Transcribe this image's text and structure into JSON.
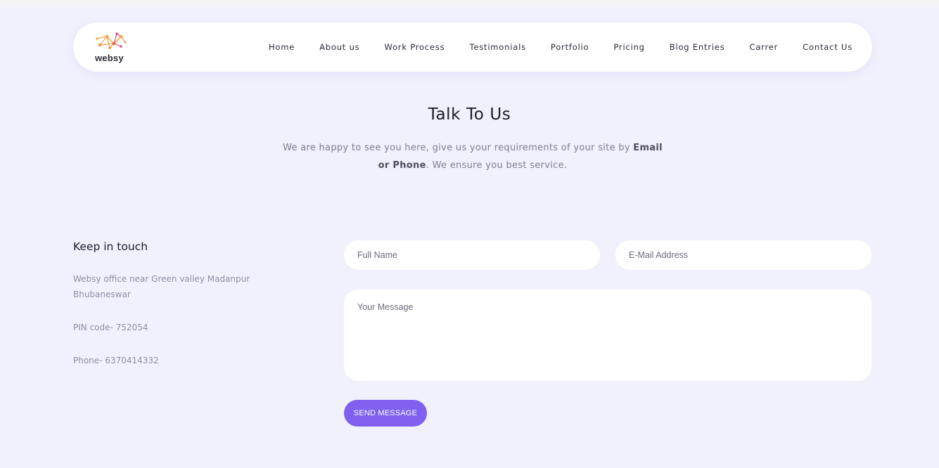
{
  "brand": {
    "name": "websy",
    "logo_icon": "network-nodes-icon",
    "logo_colors": [
      "#f3a24a",
      "#d94f7a"
    ]
  },
  "nav": {
    "items": [
      "Home",
      "About us",
      "Work Process",
      "Testimonials",
      "Portfolio",
      "Pricing",
      "Blog Entries",
      "Carrer",
      "Contact Us"
    ]
  },
  "hero": {
    "title": "Talk To Us",
    "sub_part1": "We are happy to see you here, give us your requirements of your site by ",
    "sub_bold1": "Email or Phone",
    "sub_part2": ". We ensure you best service."
  },
  "contact_info": {
    "heading": "Keep in touch",
    "address": "Websy office near Green valley Madanpur Bhubaneswar",
    "pin": "PIN code- 752054",
    "phone": "Phone- 6370414332"
  },
  "form": {
    "full_name_placeholder": "Full Name",
    "email_placeholder": "E-Mail Address",
    "message_placeholder": "Your Message",
    "submit_label": "SEND MESSAGE"
  },
  "colors": {
    "accent": "#8060ef",
    "background": "#f1f1fd"
  }
}
